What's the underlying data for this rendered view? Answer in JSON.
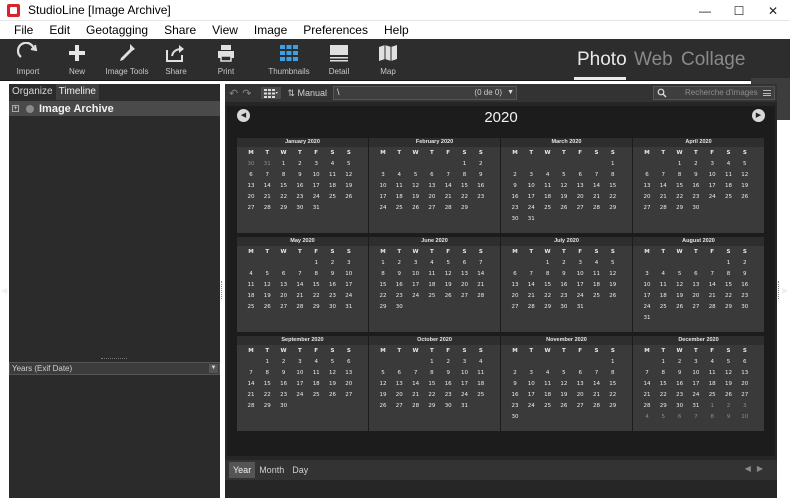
{
  "window": {
    "title": "StudioLine [Image Archive]"
  },
  "menu": [
    "File",
    "Edit",
    "Geotagging",
    "Share",
    "View",
    "Image",
    "Preferences",
    "Help"
  ],
  "toolbar": {
    "import": "Import",
    "new": "New",
    "image_tools": "Image Tools",
    "share": "Share",
    "print": "Print",
    "thumbnails": "Thumbnails",
    "detail": "Detail",
    "map": "Map"
  },
  "modes": {
    "photo": "Photo",
    "web": "Web",
    "collage": "Collage"
  },
  "left_panel": {
    "tabs": {
      "organize": "Organize",
      "timeline": "Timeline"
    },
    "tree_label": "Image Archive",
    "years_select": "Years (Exif Date)"
  },
  "nav": {
    "sort_label": "Manual",
    "path": "\\",
    "count": "(0 de 0)",
    "search_placeholder": "Recherche d'images"
  },
  "calendar": {
    "year": "2020",
    "weekdays": [
      "M",
      "T",
      "W",
      "T",
      "F",
      "S",
      "S"
    ],
    "months": [
      {
        "title": "January 2020",
        "days": [
          [
            "30",
            "31",
            "1",
            "2",
            "3",
            "4",
            "5"
          ],
          [
            "6",
            "7",
            "8",
            "9",
            "10",
            "11",
            "12"
          ],
          [
            "13",
            "14",
            "15",
            "16",
            "17",
            "18",
            "19"
          ],
          [
            "20",
            "21",
            "22",
            "23",
            "24",
            "25",
            "26"
          ],
          [
            "27",
            "28",
            "29",
            "30",
            "31",
            "",
            ""
          ]
        ]
      },
      {
        "title": "February 2020",
        "days": [
          [
            "",
            "",
            "",
            "",
            "",
            "1",
            "2"
          ],
          [
            "3",
            "4",
            "5",
            "6",
            "7",
            "8",
            "9"
          ],
          [
            "10",
            "11",
            "12",
            "13",
            "14",
            "15",
            "16"
          ],
          [
            "17",
            "18",
            "19",
            "20",
            "21",
            "22",
            "23"
          ],
          [
            "24",
            "25",
            "26",
            "27",
            "28",
            "29",
            ""
          ]
        ]
      },
      {
        "title": "March 2020",
        "days": [
          [
            "",
            "",
            "",
            "",
            "",
            "",
            "1"
          ],
          [
            "2",
            "3",
            "4",
            "5",
            "6",
            "7",
            "8"
          ],
          [
            "9",
            "10",
            "11",
            "12",
            "13",
            "14",
            "15"
          ],
          [
            "16",
            "17",
            "18",
            "19",
            "20",
            "21",
            "22"
          ],
          [
            "23",
            "24",
            "25",
            "26",
            "27",
            "28",
            "29"
          ],
          [
            "30",
            "31",
            "",
            "",
            "",
            "",
            ""
          ]
        ]
      },
      {
        "title": "April 2020",
        "days": [
          [
            "",
            "",
            "1",
            "2",
            "3",
            "4",
            "5"
          ],
          [
            "6",
            "7",
            "8",
            "9",
            "10",
            "11",
            "12"
          ],
          [
            "13",
            "14",
            "15",
            "16",
            "17",
            "18",
            "19"
          ],
          [
            "20",
            "21",
            "22",
            "23",
            "24",
            "25",
            "26"
          ],
          [
            "27",
            "28",
            "29",
            "30",
            "",
            "",
            ""
          ]
        ]
      },
      {
        "title": "May 2020",
        "days": [
          [
            "",
            "",
            "",
            "",
            "1",
            "2",
            "3"
          ],
          [
            "4",
            "5",
            "6",
            "7",
            "8",
            "9",
            "10"
          ],
          [
            "11",
            "12",
            "13",
            "14",
            "15",
            "16",
            "17"
          ],
          [
            "18",
            "19",
            "20",
            "21",
            "22",
            "23",
            "24"
          ],
          [
            "25",
            "26",
            "27",
            "28",
            "29",
            "30",
            "31"
          ]
        ]
      },
      {
        "title": "June 2020",
        "days": [
          [
            "1",
            "2",
            "3",
            "4",
            "5",
            "6",
            "7"
          ],
          [
            "8",
            "9",
            "10",
            "11",
            "12",
            "13",
            "14"
          ],
          [
            "15",
            "16",
            "17",
            "18",
            "19",
            "20",
            "21"
          ],
          [
            "22",
            "23",
            "24",
            "25",
            "26",
            "27",
            "28"
          ],
          [
            "29",
            "30",
            "",
            "",
            "",
            "",
            ""
          ]
        ]
      },
      {
        "title": "July 2020",
        "days": [
          [
            "",
            "",
            "1",
            "2",
            "3",
            "4",
            "5"
          ],
          [
            "6",
            "7",
            "8",
            "9",
            "10",
            "11",
            "12"
          ],
          [
            "13",
            "14",
            "15",
            "16",
            "17",
            "18",
            "19"
          ],
          [
            "20",
            "21",
            "22",
            "23",
            "24",
            "25",
            "26"
          ],
          [
            "27",
            "28",
            "29",
            "30",
            "31",
            "",
            ""
          ]
        ]
      },
      {
        "title": "August 2020",
        "days": [
          [
            "",
            "",
            "",
            "",
            "",
            "1",
            "2"
          ],
          [
            "3",
            "4",
            "5",
            "6",
            "7",
            "8",
            "9"
          ],
          [
            "10",
            "11",
            "12",
            "13",
            "14",
            "15",
            "16"
          ],
          [
            "17",
            "18",
            "19",
            "20",
            "21",
            "22",
            "23"
          ],
          [
            "24",
            "25",
            "26",
            "27",
            "28",
            "29",
            "30"
          ],
          [
            "31",
            "",
            "",
            "",
            "",
            "",
            ""
          ]
        ]
      },
      {
        "title": "September 2020",
        "days": [
          [
            "",
            "1",
            "2",
            "3",
            "4",
            "5",
            "6"
          ],
          [
            "7",
            "8",
            "9",
            "10",
            "11",
            "12",
            "13"
          ],
          [
            "14",
            "15",
            "16",
            "17",
            "18",
            "19",
            "20"
          ],
          [
            "21",
            "22",
            "23",
            "24",
            "25",
            "26",
            "27"
          ],
          [
            "28",
            "29",
            "30",
            "",
            "",
            "",
            ""
          ]
        ]
      },
      {
        "title": "October 2020",
        "days": [
          [
            "",
            "",
            "",
            "1",
            "2",
            "3",
            "4"
          ],
          [
            "5",
            "6",
            "7",
            "8",
            "9",
            "10",
            "11"
          ],
          [
            "12",
            "13",
            "14",
            "15",
            "16",
            "17",
            "18"
          ],
          [
            "19",
            "20",
            "21",
            "22",
            "23",
            "24",
            "25"
          ],
          [
            "26",
            "27",
            "28",
            "29",
            "30",
            "31",
            ""
          ]
        ]
      },
      {
        "title": "November 2020",
        "days": [
          [
            "",
            "",
            "",
            "",
            "",
            "",
            "1"
          ],
          [
            "2",
            "3",
            "4",
            "5",
            "6",
            "7",
            "8"
          ],
          [
            "9",
            "10",
            "11",
            "12",
            "13",
            "14",
            "15"
          ],
          [
            "16",
            "17",
            "18",
            "19",
            "20",
            "21",
            "22"
          ],
          [
            "23",
            "24",
            "25",
            "26",
            "27",
            "28",
            "29"
          ],
          [
            "30",
            "",
            "",
            "",
            "",
            "",
            ""
          ]
        ]
      },
      {
        "title": "December 2020",
        "days": [
          [
            "",
            "1",
            "2",
            "3",
            "4",
            "5",
            "6"
          ],
          [
            "7",
            "8",
            "9",
            "10",
            "11",
            "12",
            "13"
          ],
          [
            "14",
            "15",
            "16",
            "17",
            "18",
            "19",
            "20"
          ],
          [
            "21",
            "22",
            "23",
            "24",
            "25",
            "26",
            "27"
          ],
          [
            "28",
            "29",
            "30",
            "31",
            "1",
            "2",
            "3"
          ],
          [
            "4",
            "5",
            "6",
            "7",
            "8",
            "9",
            "10"
          ]
        ]
      }
    ],
    "other_month_days": {
      "0": [
        [
          0,
          0
        ],
        [
          0,
          1
        ]
      ],
      "11": [
        [
          4,
          4
        ],
        [
          4,
          5
        ],
        [
          4,
          6
        ],
        [
          5,
          0
        ],
        [
          5,
          1
        ],
        [
          5,
          2
        ],
        [
          5,
          3
        ],
        [
          5,
          4
        ],
        [
          5,
          5
        ],
        [
          5,
          6
        ]
      ]
    }
  },
  "bottom_tabs": {
    "year": "Year",
    "month": "Month",
    "day": "Day"
  }
}
